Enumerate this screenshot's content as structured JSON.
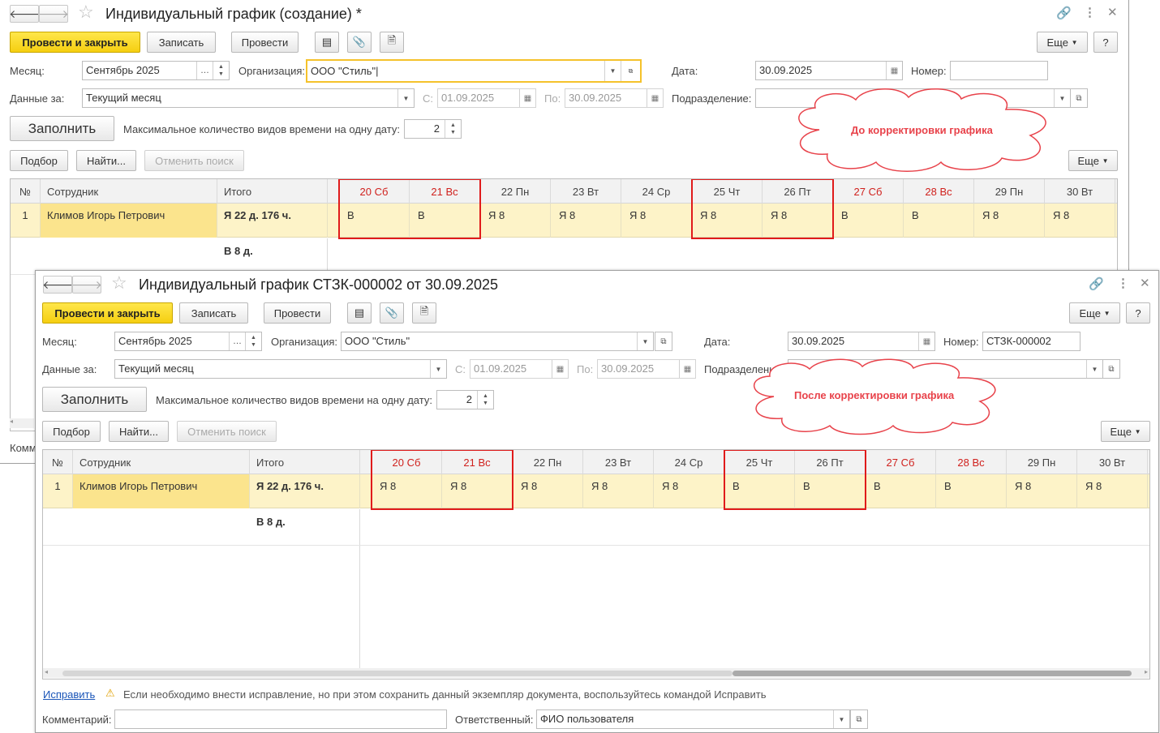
{
  "w1": {
    "title": "Индивидуальный график (создание) *",
    "post_close": "Провести и закрыть",
    "save": "Записать",
    "post": "Провести",
    "more": "Еще",
    "help": "?",
    "month_label": "Месяц:",
    "month_value": "Сентябрь 2025",
    "org_label": "Организация:",
    "org_value": "ООО \"Стиль\"",
    "date_label": "Дата:",
    "date_value": "30.09.2025",
    "number_label": "Номер:",
    "number_value": "",
    "data_for_label": "Данные за:",
    "data_for_value": "Текущий месяц",
    "from_label": "С:",
    "from_value": "01.09.2025",
    "to_label": "По:",
    "to_value": "30.09.2025",
    "dept_label": "Подразделение:",
    "dept_value": "",
    "fill": "Заполнить",
    "maxtypes_label": "Максимальное количество видов времени на одну дату:",
    "maxtypes_value": "2",
    "pick": "Подбор",
    "find": "Найти...",
    "cancel_search": "Отменить поиск",
    "more2": "Еще",
    "grid": {
      "h_no": "№",
      "h_emp": "Сотрудник",
      "h_total": "Итого",
      "days": [
        "20 Сб",
        "21 Вс",
        "22 Пн",
        "23 Вт",
        "24 Ср",
        "25 Чт",
        "26 Пт",
        "27 Сб",
        "28 Вс",
        "29 Пн",
        "30 Вт"
      ],
      "row_no": "1",
      "row_emp": "Климов Игорь Петрович",
      "row_total": "Я 22 д. 176 ч.",
      "row_cells": [
        "В",
        "В",
        "Я 8",
        "Я 8",
        "Я 8",
        "Я 8",
        "Я 8",
        "В",
        "В",
        "Я 8",
        "Я 8"
      ],
      "foot_total": "В 8 д."
    },
    "cloud_text": "До корректировки графика",
    "bottom_label": "Комм"
  },
  "w2": {
    "title": "Индивидуальный график СТЗК-000002 от 30.09.2025",
    "post_close": "Провести и закрыть",
    "save": "Записать",
    "post": "Провести",
    "more": "Еще",
    "help": "?",
    "month_label": "Месяц:",
    "month_value": "Сентябрь 2025",
    "org_label": "Организация:",
    "org_value": "ООО \"Стиль\"",
    "date_label": "Дата:",
    "date_value": "30.09.2025",
    "number_label": "Номер:",
    "number_value": "СТЗК-000002",
    "data_for_label": "Данные за:",
    "data_for_value": "Текущий месяц",
    "from_label": "С:",
    "from_value": "01.09.2025",
    "to_label": "По:",
    "to_value": "30.09.2025",
    "dept_label": "Подразделение:",
    "dept_value": "",
    "fill": "Заполнить",
    "maxtypes_label": "Максимальное количество видов времени на одну дату:",
    "maxtypes_value": "2",
    "pick": "Подбор",
    "find": "Найти...",
    "cancel_search": "Отменить поиск",
    "more2": "Еще",
    "grid": {
      "h_no": "№",
      "h_emp": "Сотрудник",
      "h_total": "Итого",
      "days": [
        "20 Сб",
        "21 Вс",
        "22 Пн",
        "23 Вт",
        "24 Ср",
        "25 Чт",
        "26 Пт",
        "27 Сб",
        "28 Вс",
        "29 Пн",
        "30 Вт"
      ],
      "row_no": "1",
      "row_emp": "Климов Игорь Петрович",
      "row_total": "Я 22 д. 176 ч.",
      "row_cells": [
        "Я 8",
        "Я 8",
        "Я 8",
        "Я 8",
        "Я 8",
        "В",
        "В",
        "В",
        "В",
        "Я 8",
        "Я 8"
      ],
      "foot_total": "В 8 д."
    },
    "cloud_text": "После корректировки графика",
    "fix_link": "Исправить",
    "fix_note": "Если необходимо внести исправление, но при этом сохранить данный экземпляр документа, воспользуйтесь командой Исправить",
    "comment_label": "Комментарий:",
    "comment_value": "",
    "resp_label": "Ответственный:",
    "resp_value": "ФИО пользователя"
  },
  "colors": {
    "weekend": "#d0211d",
    "highlight": "#e01b1b",
    "accent": "#f5cf11",
    "cloud_text": "#e8434b"
  }
}
